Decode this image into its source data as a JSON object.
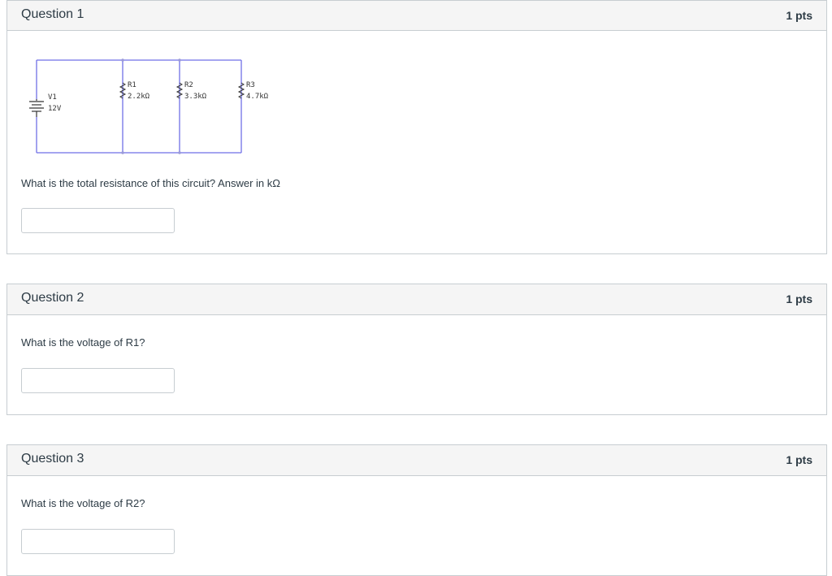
{
  "questions": [
    {
      "title": "Question 1",
      "points": "1 pts",
      "text": "What is the total resistance of this circuit? Answer in kΩ",
      "answer_value": "",
      "circuit": {
        "source": {
          "name": "V1",
          "value": "12V"
        },
        "resistors": [
          {
            "name": "R1",
            "value": "2.2kΩ"
          },
          {
            "name": "R2",
            "value": "3.3kΩ"
          },
          {
            "name": "R3",
            "value": "4.7kΩ"
          }
        ],
        "wire_color": "#6f6fe6"
      }
    },
    {
      "title": "Question 2",
      "points": "1 pts",
      "text": "What is the voltage of R1?",
      "answer_value": ""
    },
    {
      "title": "Question 3",
      "points": "1 pts",
      "text": "What is the voltage of R2?",
      "answer_value": ""
    }
  ]
}
